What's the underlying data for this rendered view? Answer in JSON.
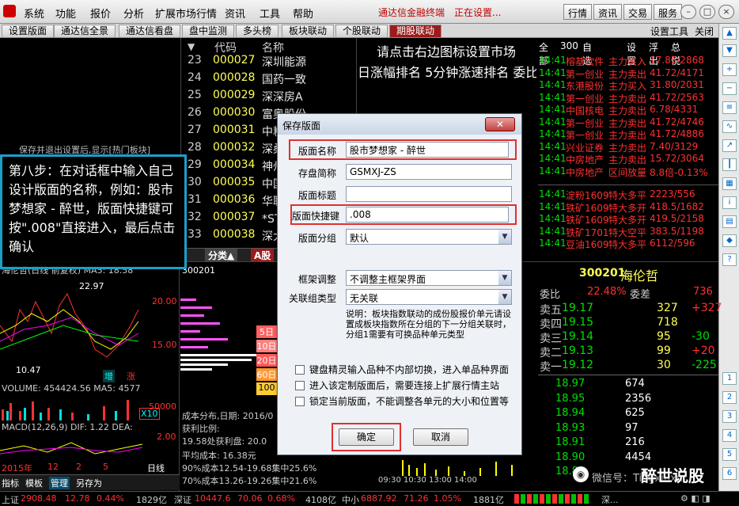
{
  "menu": {
    "items": [
      "系统",
      "功能",
      "报价",
      "分析",
      "扩展市场行情",
      "资讯",
      "工具",
      "帮助"
    ],
    "brand": "通达信金融终端",
    "status": "正在设置...",
    "right_buttons": [
      "行情",
      "资讯",
      "交易",
      "服务"
    ]
  },
  "tabs": {
    "items": [
      "设置版面",
      "通达信全景",
      "通达信看盘",
      "盘中监测",
      "多头榜",
      "板块联动",
      "个股联动",
      "期股联动"
    ],
    "right": [
      "设置工具",
      "关闭"
    ]
  },
  "stock_list": {
    "headers": [
      "代码",
      "名称"
    ],
    "banner": "请点击右边图标设置市场",
    "sub_banner": "日涨幅排名 5分钟涨速排名 委比前排",
    "rows": [
      {
        "n": "23",
        "code": "000027",
        "name": "深圳能源"
      },
      {
        "n": "24",
        "code": "000028",
        "name": "国药一致"
      },
      {
        "n": "25",
        "code": "000029",
        "name": "深深房A"
      },
      {
        "n": "26",
        "code": "000030",
        "name": "富奥股份"
      },
      {
        "n": "27",
        "code": "000031",
        "name": "中粮地产"
      },
      {
        "n": "28",
        "code": "000032",
        "name": "深桑达A"
      },
      {
        "n": "29",
        "code": "000034",
        "name": "神州数码"
      },
      {
        "n": "30",
        "code": "000035",
        "name": "中国天楹"
      },
      {
        "n": "31",
        "code": "000036",
        "name": "华联控股"
      },
      {
        "n": "32",
        "code": "000037",
        "name": "*ST南电A"
      },
      {
        "n": "33",
        "code": "000038",
        "name": "深大通"
      }
    ],
    "footer": [
      "分类▲",
      "A股"
    ]
  },
  "right_panel": {
    "header": [
      "全部",
      "300",
      "自选",
      "设置",
      "浮出",
      "总悦"
    ],
    "flow": [
      {
        "t": "14:41",
        "name": "榕基软件",
        "act": "主力买入",
        "val": "17.85/2868"
      },
      {
        "t": "14:41",
        "name": "第一创业",
        "act": "主力卖出",
        "val": "41.72/4171"
      },
      {
        "t": "14:41",
        "name": "东港股份",
        "act": "主力买入",
        "val": "31.80/2031"
      },
      {
        "t": "14:41",
        "name": "第一创业",
        "act": "主力卖出",
        "val": "41.72/2563"
      },
      {
        "t": "14:41",
        "name": "中国核电",
        "act": "主力卖出",
        "val": "6.78/4331"
      },
      {
        "t": "14:41",
        "name": "第一创业",
        "act": "主力卖出",
        "val": "41.72/4746"
      },
      {
        "t": "14:41",
        "name": "第一创业",
        "act": "主力卖出",
        "val": "41.72/4886"
      },
      {
        "t": "14:41",
        "name": "兴业证券",
        "act": "主力卖出",
        "val": "7.40/3129"
      },
      {
        "t": "14:41",
        "name": "中房地产",
        "act": "主力卖出",
        "val": "15.72/3064"
      },
      {
        "t": "14:41",
        "name": "中房地产",
        "act": "区间放量",
        "val": "8.8倍-0.13%"
      }
    ],
    "futures": [
      {
        "t": "14:41",
        "name": "淀粉1609",
        "act": "特大多平",
        "val": "2223/556"
      },
      {
        "t": "14:41",
        "name": "铁矿1609",
        "act": "特大多开",
        "val": "418.5/1682"
      },
      {
        "t": "14:41",
        "name": "铁矿1609",
        "act": "特大多开",
        "val": "419.5/2158"
      },
      {
        "t": "14:41",
        "name": "铁矿1701",
        "act": "特大空平",
        "val": "383.5/1198"
      },
      {
        "t": "14:41",
        "name": "豆油1609",
        "act": "特大多平",
        "val": "6112/596"
      }
    ],
    "quote": {
      "code": "300201",
      "name": "海伦哲",
      "weibi_label": "委比",
      "weibi": "22.48%",
      "weicha_label": "委差",
      "weicha": "736"
    },
    "asks": [
      {
        "l": "卖五",
        "p": "19.17",
        "v": "327",
        "c": "+327"
      },
      {
        "l": "卖四",
        "p": "19.15",
        "v": "718",
        "c": ""
      },
      {
        "l": "卖三",
        "p": "19.14",
        "v": "95",
        "c": "-30"
      },
      {
        "l": "卖二",
        "p": "19.13",
        "v": "99",
        "c": "+20"
      },
      {
        "l": "卖一",
        "p": "19.12",
        "v": "30",
        "c": "-225"
      }
    ],
    "bids": [
      {
        "p": "18.97",
        "v": "674"
      },
      {
        "p": "18.95",
        "v": "2356"
      },
      {
        "p": "18.94",
        "v": "625"
      },
      {
        "p": "18.93",
        "v": "97"
      },
      {
        "p": "18.91",
        "v": "216"
      },
      {
        "p": "18.90",
        "v": "4454"
      },
      {
        "p": "18.89",
        "v": ""
      }
    ]
  },
  "left_chart": {
    "title": "海伦哲(日线 前复权) MA5: 18.58",
    "hi": "22.97",
    "lo": "10.47",
    "axis": [
      "20.00",
      "15.00"
    ],
    "vol": "VOLUME: 454424.56 MA5: 4577",
    "vol_axis": "50000",
    "macd": "MACD(12,26,9) DIF: 1.22 DEA:",
    "macd_axis": "2.00",
    "x10": "X10",
    "xlabels": [
      "2015年",
      "12",
      "2",
      "5"
    ],
    "period": "日线",
    "tabs": [
      "指标",
      "模板",
      "管理",
      "另存为"
    ],
    "hint": "保存并退出设置后,显示[热门板块]"
  },
  "mid_chart": {
    "code": "300201",
    "dist": "成本分布,日期: 2016/0",
    "profit": "获利比例:",
    "profit_detail": "19.58处获利盘: 20.0",
    "avg": "平均成本: 16.38元",
    "c90": "90%成本12.54-19.68集中25.6%",
    "c70": "70%成本13.26-19.26集中21.6%",
    "levels": [
      "5日",
      "10日",
      "20日",
      "60日",
      "100"
    ],
    "time": "09:30 10:30 13:00 14:00"
  },
  "annotation": {
    "text": "第八步：在对话框中输入自己设计版面的名称，例如：股市梦想家 - 醉世，版面快捷键可按\".008\"直接进入，最后点击确认"
  },
  "dialog": {
    "title": "保存版面",
    "fields": {
      "name_label": "版面名称",
      "name_value": "股市梦想家 - 醉世",
      "abbr_label": "存盘简称",
      "abbr_value": "GSMXJ-ZS",
      "caption_label": "版面标题",
      "caption_value": "",
      "shortcut_label": "版面快捷键",
      "shortcut_value": ".008",
      "group_label": "版面分组",
      "group_value": "默认",
      "frame_label": "框架调整",
      "frame_value": "不调整主框架界面",
      "link_label": "关联组类型",
      "link_value": "无关联"
    },
    "note": "说明：板块指数联动的成份股报价单元请设置成板块指数所在分组的下一分组关联时，分组1需要有可换品种单元类型",
    "checks": [
      "键盘精灵输入品种不内部切换，进入单品种界面",
      "进入该定制版面后，需要连接上扩展行情主站",
      "锁定当前版面，不能调整各单元的大小和位置等"
    ],
    "ok": "确定",
    "cancel": "取消"
  },
  "status": {
    "sh_label": "上证",
    "sh": "2908.48",
    "sh_chg": "12.78",
    "sh_pct": "0.44%",
    "sh_amt": "1829亿",
    "sz_label": "深证",
    "sz": "10447.6",
    "sz_chg": "70.06",
    "sz_pct": "0.68%",
    "sz_amt": "4108亿",
    "zx_label": "中小",
    "zx": "6887.92",
    "zx_chg": "71.26",
    "zx_pct": "1.05%",
    "zx_amt": "1881亿",
    "more": "深..."
  },
  "watermark": "微信号：Tingxiuxu",
  "logo": "醉世说股",
  "colors": {
    "accent": "#9c1c1c",
    "highlight": "#e03030",
    "annotation_border": "#1aa0c8"
  }
}
